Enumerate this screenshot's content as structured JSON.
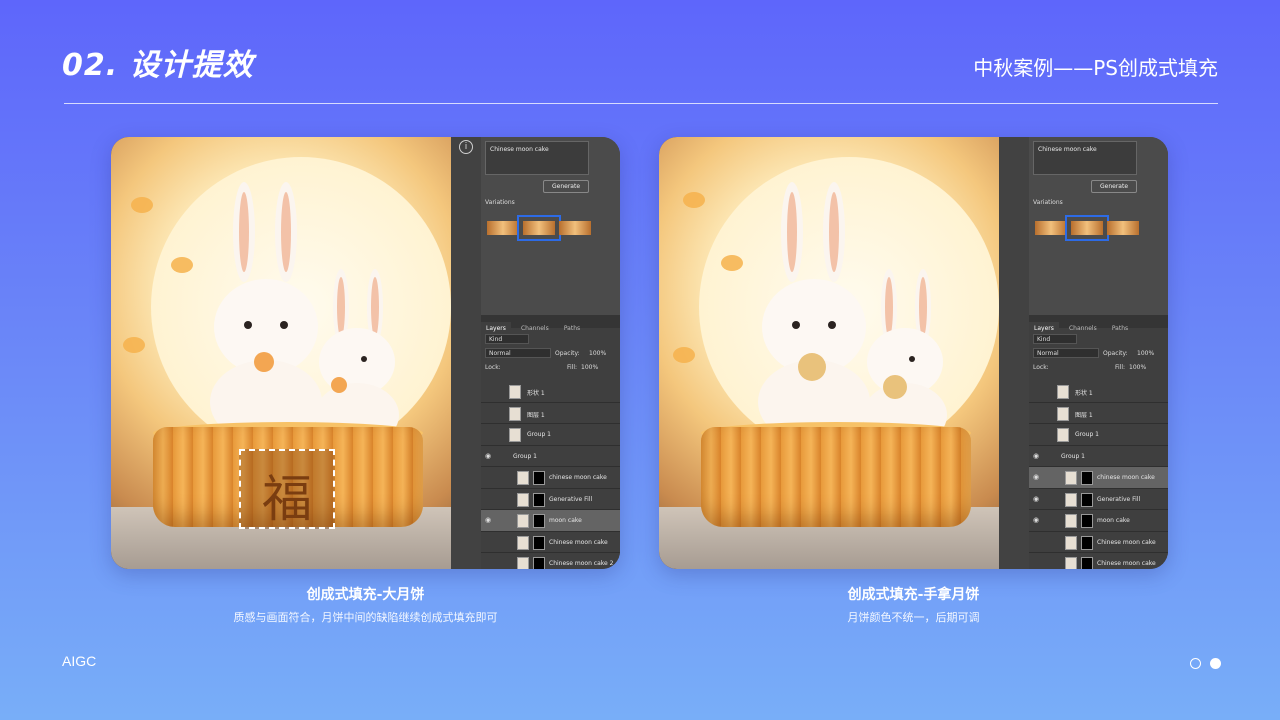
{
  "header": {
    "title": "02. 设计提效",
    "subtitle": "中秋案例——PS创成式填充"
  },
  "panels": [
    {
      "prompt": "Chinese moon cake",
      "generate_label": "Generate",
      "variations_label": "Variations",
      "tabs": [
        "Layers",
        "Channels",
        "Paths"
      ],
      "kind_label": "Kind",
      "blend_mode": "Normal",
      "opacity_label": "Opacity:",
      "opacity_value": "100%",
      "lock_label": "Lock:",
      "fill_label": "Fill:",
      "fill_value": "100%",
      "layers": [
        {
          "name": "形状 1"
        },
        {
          "name": "图层 1"
        },
        {
          "name": "Group 1"
        },
        {
          "name": "Group 1"
        },
        {
          "name": "chinese moon cake"
        },
        {
          "name": "Generative Fill"
        },
        {
          "name": "moon cake"
        },
        {
          "name": "Chinese moon cake"
        },
        {
          "name": "Chinese moon cake 2"
        }
      ]
    },
    {
      "prompt": "Chinese moon cake",
      "generate_label": "Generate",
      "variations_label": "Variations",
      "tabs": [
        "Layers",
        "Channels",
        "Paths"
      ],
      "kind_label": "Kind",
      "blend_mode": "Normal",
      "opacity_label": "Opacity:",
      "opacity_value": "100%",
      "lock_label": "Lock:",
      "fill_label": "Fill:",
      "fill_value": "100%",
      "layers": [
        {
          "name": "形状 1"
        },
        {
          "name": "图层 1"
        },
        {
          "name": "Group 1"
        },
        {
          "name": "Group 1"
        },
        {
          "name": "chinese moon cake"
        },
        {
          "name": "Generative Fill"
        },
        {
          "name": "moon cake"
        },
        {
          "name": "Chinese moon cake"
        },
        {
          "name": "Chinese moon cake"
        }
      ]
    }
  ],
  "captions": [
    {
      "title": "创成式填充-大月饼",
      "desc": "质感与画面符合，月饼中间的缺陷继续创成式填充即可"
    },
    {
      "title": "创成式填充-手拿月饼",
      "desc": "月饼颜色不统一，后期可调"
    }
  ],
  "footer": {
    "brand": "AIGC"
  },
  "colors": {
    "accent": "#5e66fb",
    "selection": "#2d6be6"
  }
}
